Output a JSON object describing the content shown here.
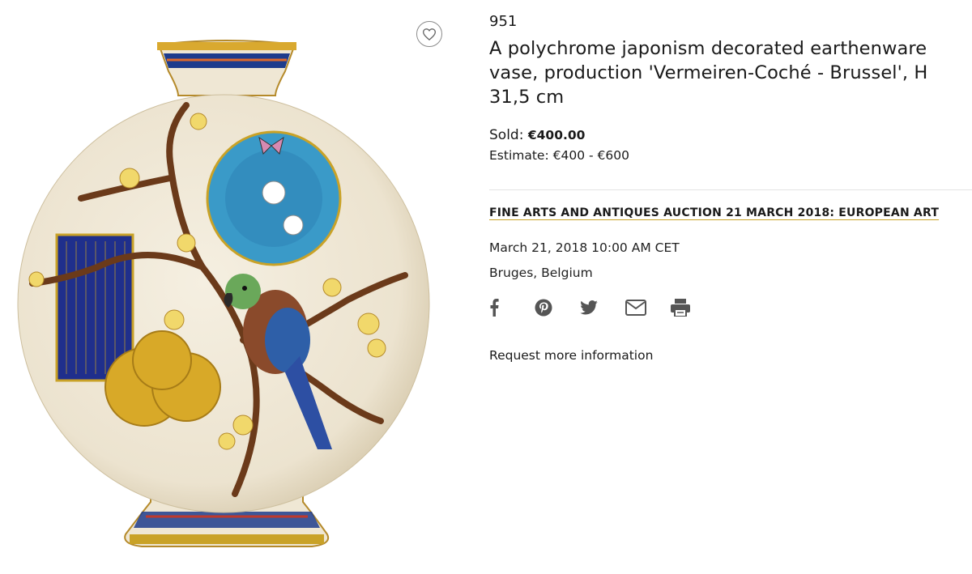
{
  "lot": {
    "number": "951",
    "title": "A polychrome japonism decorated earthenware vase, production 'Vermeiren-Coché - Brussel', H 31,5 cm",
    "sold_label": "Sold:",
    "sold_value": "€400.00",
    "estimate": "Estimate: €400 - €600"
  },
  "auction": {
    "link_text": "FINE ARTS AND ANTIQUES AUCTION 21 MARCH 2018: EUROPEAN ART",
    "date": "March 21, 2018 10:00 AM CET",
    "location": "Bruges, Belgium"
  },
  "share": [
    "facebook-icon",
    "pinterest-icon",
    "twitter-icon",
    "mail-icon",
    "print-icon"
  ],
  "request_info": "Request more information",
  "colors": {
    "accent_underline": "#c9a227",
    "icon": "#555555"
  }
}
